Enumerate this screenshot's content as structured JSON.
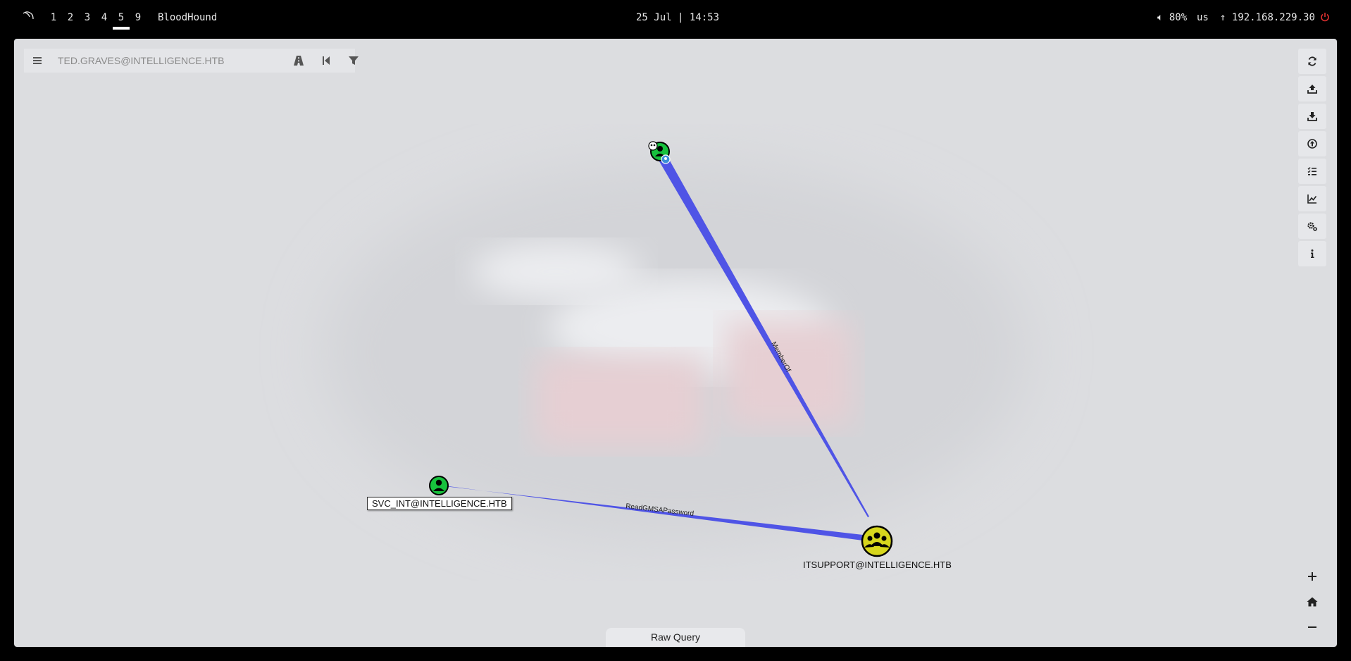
{
  "topbar": {
    "workspaces": [
      "1",
      "2",
      "3",
      "4",
      "5",
      "9"
    ],
    "active_workspace": "5",
    "window_title": "BloodHound",
    "clock": "25 Jul | 14:53",
    "volume": "80%",
    "keyboard": "us",
    "ip": "192.168.229.30",
    "icons": [
      "kali-logo-icon",
      "volume-icon",
      "network-icon",
      "power-icon"
    ]
  },
  "search": {
    "placeholder": "TED.GRAVES@INTELLIGENCE.HTB",
    "value": "",
    "icons": [
      "hamburger-menu-icon",
      "pathfinding-road-icon",
      "back-icon",
      "filter-icon"
    ]
  },
  "right_toolbar": [
    "refresh-icon",
    "upload-icon",
    "export-icon",
    "import-icon",
    "queue-icon",
    "chart-icon",
    "settings-icon",
    "info-icon"
  ],
  "zoom_toolbar": [
    "zoom-in-icon",
    "home-icon",
    "zoom-out-icon"
  ],
  "raw_query": {
    "label": "Raw Query"
  },
  "graph": {
    "nodes": [
      {
        "id": "group-member",
        "label": "",
        "type": "user",
        "highlighted": true
      },
      {
        "id": "svc_int",
        "label": "SVC_INT@INTELLIGENCE.HTB",
        "type": "user"
      },
      {
        "id": "itsupport",
        "label": "ITSUPPORT@INTELLIGENCE.HTB",
        "type": "group"
      }
    ],
    "edges": [
      {
        "from": "group-member",
        "to": "itsupport",
        "label": "MemberOf"
      },
      {
        "from": "itsupport",
        "to": "svc_int",
        "label": "ReadGMSAPassword"
      }
    ],
    "colors": {
      "edge": "#4f54e6",
      "user": "#17c13d",
      "group": "#d6d61d",
      "node_border": "#000000"
    }
  }
}
